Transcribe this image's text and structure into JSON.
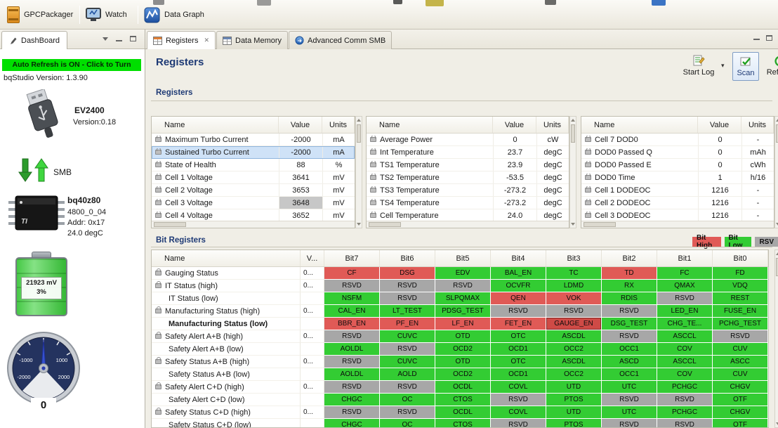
{
  "colors": {
    "bit_high": "#e05a56",
    "bit_low": "#33cc33",
    "bit_rsvd": "#a7a7a7",
    "accent_navy": "#1e3a75",
    "banner_green": "#00df00",
    "selection_blue": "#cfe2f7"
  },
  "toolbar": {
    "items": [
      {
        "label": "GPCPackager"
      },
      {
        "label": "Watch"
      },
      {
        "label": "Data Graph"
      }
    ]
  },
  "dashboard": {
    "tab_label": "DashBoard",
    "auto_refresh_banner": "Auto Refresh is ON - Click to Turn",
    "studio_version": "bqStudio Version: 1.3.90",
    "adapter_name": "EV2400",
    "adapter_version": "Version:0.18",
    "bus_label": "SMB",
    "device_name": "bq40z80",
    "device_fw": "4800_0_04",
    "device_addr": "Addr: 0x17",
    "device_temp": "24.0 degC",
    "battery_voltage": "21923 mV",
    "battery_soc": "3%",
    "gauge_labels": {
      "left": "-1000",
      "right": "1000",
      "lower_left": "-2000",
      "lower_right": "2000"
    },
    "gauge_value": "0"
  },
  "editor_tabs": [
    {
      "label": "Registers",
      "active": true
    },
    {
      "label": "Data Memory",
      "active": false
    },
    {
      "label": "Advanced Comm SMB",
      "active": false
    }
  ],
  "page_title": "Registers",
  "actions": {
    "start_log": "Start Log",
    "scan": "Scan",
    "refresh": "Refresh"
  },
  "registers_section": {
    "title": "Registers",
    "columns": [
      "Name",
      "Value",
      "Units"
    ],
    "tables": [
      {
        "rows": [
          {
            "name": "Maximum Turbo Current",
            "value": "-2000",
            "units": "mA"
          },
          {
            "name": "Sustained Turbo Current",
            "value": "-2000",
            "units": "mA",
            "selected": true
          },
          {
            "name": "State of Health",
            "value": "88",
            "units": "%"
          },
          {
            "name": "Cell 1 Voltage",
            "value": "3641",
            "units": "mV"
          },
          {
            "name": "Cell 2 Voltage",
            "value": "3653",
            "units": "mV"
          },
          {
            "name": "Cell 3 Voltage",
            "value": "3648",
            "units": "mV",
            "value_selected": true
          },
          {
            "name": "Cell 4 Voltage",
            "value": "3652",
            "units": "mV"
          }
        ]
      },
      {
        "rows": [
          {
            "name": "Average Power",
            "value": "0",
            "units": "cW"
          },
          {
            "name": "Int Temperature",
            "value": "23.7",
            "units": "degC"
          },
          {
            "name": "TS1 Temperature",
            "value": "23.9",
            "units": "degC"
          },
          {
            "name": "TS2 Temperature",
            "value": "-53.5",
            "units": "degC"
          },
          {
            "name": "TS3 Temperature",
            "value": "-273.2",
            "units": "degC"
          },
          {
            "name": "TS4 Temperature",
            "value": "-273.2",
            "units": "degC"
          },
          {
            "name": "Cell Temperature",
            "value": "24.0",
            "units": "degC"
          }
        ]
      },
      {
        "rows": [
          {
            "name": "Cell 7 DOD0",
            "value": "0",
            "units": "-"
          },
          {
            "name": "DOD0 Passed Q",
            "value": "0",
            "units": "mAh"
          },
          {
            "name": "DOD0 Passed E",
            "value": "0",
            "units": "cWh"
          },
          {
            "name": "DOD0 Time",
            "value": "1",
            "units": "h/16"
          },
          {
            "name": "Cell 1 DODEOC",
            "value": "1216",
            "units": "-"
          },
          {
            "name": "Cell 2 DODEOC",
            "value": "1216",
            "units": "-"
          },
          {
            "name": "Cell 3 DODEOC",
            "value": "1216",
            "units": "-"
          }
        ]
      }
    ]
  },
  "bit_section": {
    "title": "Bit Registers",
    "legend": [
      {
        "label": "Bit High",
        "type": "high"
      },
      {
        "label": "Bit Low",
        "type": "low"
      },
      {
        "label": "RSV",
        "type": "rsvd"
      }
    ],
    "columns": [
      "Name",
      "V...",
      "Bit7",
      "Bit6",
      "Bit5",
      "Bit4",
      "Bit3",
      "Bit2",
      "Bit1",
      "Bit0"
    ],
    "rows": [
      {
        "name": "Gauging Status",
        "lock": true,
        "value": "0...",
        "bits": [
          {
            "label": "CF",
            "state": "high"
          },
          {
            "label": "DSG",
            "state": "high"
          },
          {
            "label": "EDV",
            "state": "low"
          },
          {
            "label": "BAL_EN",
            "state": "low"
          },
          {
            "label": "TC",
            "state": "low"
          },
          {
            "label": "TD",
            "state": "high"
          },
          {
            "label": "FC",
            "state": "low"
          },
          {
            "label": "FD",
            "state": "low"
          }
        ]
      },
      {
        "name": "IT Status (high)",
        "lock": true,
        "value": "0...",
        "bits": [
          {
            "label": "RSVD",
            "state": "rsvd"
          },
          {
            "label": "RSVD",
            "state": "rsvd"
          },
          {
            "label": "RSVD",
            "state": "rsvd"
          },
          {
            "label": "OCVFR",
            "state": "low"
          },
          {
            "label": "LDMD",
            "state": "low"
          },
          {
            "label": "RX",
            "state": "low"
          },
          {
            "label": "QMAX",
            "state": "low"
          },
          {
            "label": "VDQ",
            "state": "low"
          }
        ]
      },
      {
        "name": "IT Status (low)",
        "indent": true,
        "value": "",
        "bits": [
          {
            "label": "NSFM",
            "state": "low"
          },
          {
            "label": "RSVD",
            "state": "rsvd"
          },
          {
            "label": "SLPQMAX",
            "state": "low"
          },
          {
            "label": "QEN",
            "state": "high"
          },
          {
            "label": "VOK",
            "state": "high"
          },
          {
            "label": "RDIS",
            "state": "low"
          },
          {
            "label": "RSVD",
            "state": "rsvd"
          },
          {
            "label": "REST",
            "state": "low"
          }
        ]
      },
      {
        "name": "Manufacturing Status (high)",
        "lock": true,
        "value": "0...",
        "bits": [
          {
            "label": "CAL_EN",
            "state": "low"
          },
          {
            "label": "LT_TEST",
            "state": "low"
          },
          {
            "label": "PDSG_TEST",
            "state": "low"
          },
          {
            "label": "RSVD",
            "state": "rsvd"
          },
          {
            "label": "RSVD",
            "state": "rsvd"
          },
          {
            "label": "RSVD",
            "state": "rsvd"
          },
          {
            "label": "LED_EN",
            "state": "low"
          },
          {
            "label": "FUSE_EN",
            "state": "low"
          }
        ]
      },
      {
        "name": "Manufacturing Status (low)",
        "indent": true,
        "bold": true,
        "value": "",
        "bits": [
          {
            "label": "BBR_EN",
            "state": "high"
          },
          {
            "label": "PF_EN",
            "state": "high"
          },
          {
            "label": "LF_EN",
            "state": "high"
          },
          {
            "label": "FET_EN",
            "state": "high"
          },
          {
            "label": "GAUGE_EN",
            "state": "high",
            "selected": true
          },
          {
            "label": "DSG_TEST",
            "state": "low"
          },
          {
            "label": "CHG_TE...",
            "state": "low"
          },
          {
            "label": "PCHG_TEST",
            "state": "low"
          }
        ]
      },
      {
        "name": "Safety Alert A+B (high)",
        "lock": true,
        "value": "0...",
        "bits": [
          {
            "label": "RSVD",
            "state": "rsvd"
          },
          {
            "label": "CUVC",
            "state": "low"
          },
          {
            "label": "OTD",
            "state": "low"
          },
          {
            "label": "OTC",
            "state": "low"
          },
          {
            "label": "ASCDL",
            "state": "low"
          },
          {
            "label": "RSVD",
            "state": "rsvd"
          },
          {
            "label": "ASCCL",
            "state": "low"
          },
          {
            "label": "RSVD",
            "state": "rsvd"
          }
        ]
      },
      {
        "name": "Safety Alert A+B (low)",
        "indent": true,
        "value": "",
        "bits": [
          {
            "label": "AOLDL",
            "state": "low"
          },
          {
            "label": "RSVD",
            "state": "rsvd"
          },
          {
            "label": "OCD2",
            "state": "low"
          },
          {
            "label": "OCD1",
            "state": "low"
          },
          {
            "label": "OCC2",
            "state": "low"
          },
          {
            "label": "OCC1",
            "state": "low"
          },
          {
            "label": "COV",
            "state": "low"
          },
          {
            "label": "CUV",
            "state": "low"
          }
        ]
      },
      {
        "name": "Safety Status A+B (high)",
        "lock": true,
        "value": "0...",
        "bits": [
          {
            "label": "RSVD",
            "state": "rsvd"
          },
          {
            "label": "CUVC",
            "state": "low"
          },
          {
            "label": "OTD",
            "state": "low"
          },
          {
            "label": "OTC",
            "state": "low"
          },
          {
            "label": "ASCDL",
            "state": "low"
          },
          {
            "label": "ASCD",
            "state": "low"
          },
          {
            "label": "ASCCL",
            "state": "low"
          },
          {
            "label": "ASCC",
            "state": "low"
          }
        ]
      },
      {
        "name": "Safety Status A+B (low)",
        "indent": true,
        "value": "",
        "bits": [
          {
            "label": "AOLDL",
            "state": "low"
          },
          {
            "label": "AOLD",
            "state": "low"
          },
          {
            "label": "OCD2",
            "state": "low"
          },
          {
            "label": "OCD1",
            "state": "low"
          },
          {
            "label": "OCC2",
            "state": "low"
          },
          {
            "label": "OCC1",
            "state": "low"
          },
          {
            "label": "COV",
            "state": "low"
          },
          {
            "label": "CUV",
            "state": "low"
          }
        ]
      },
      {
        "name": "Safety Alert C+D (high)",
        "lock": true,
        "value": "0...",
        "bits": [
          {
            "label": "RSVD",
            "state": "rsvd"
          },
          {
            "label": "RSVD",
            "state": "rsvd"
          },
          {
            "label": "OCDL",
            "state": "low"
          },
          {
            "label": "COVL",
            "state": "low"
          },
          {
            "label": "UTD",
            "state": "low"
          },
          {
            "label": "UTC",
            "state": "low"
          },
          {
            "label": "PCHGC",
            "state": "low"
          },
          {
            "label": "CHGV",
            "state": "low"
          }
        ]
      },
      {
        "name": "Safety Alert C+D (low)",
        "indent": true,
        "value": "",
        "bits": [
          {
            "label": "CHGC",
            "state": "low"
          },
          {
            "label": "OC",
            "state": "low"
          },
          {
            "label": "CTOS",
            "state": "low"
          },
          {
            "label": "RSVD",
            "state": "rsvd"
          },
          {
            "label": "PTOS",
            "state": "low"
          },
          {
            "label": "RSVD",
            "state": "rsvd"
          },
          {
            "label": "RSVD",
            "state": "rsvd"
          },
          {
            "label": "OTF",
            "state": "low"
          }
        ]
      },
      {
        "name": "Safety Status C+D (high)",
        "lock": true,
        "value": "0...",
        "bits": [
          {
            "label": "RSVD",
            "state": "rsvd"
          },
          {
            "label": "RSVD",
            "state": "rsvd"
          },
          {
            "label": "OCDL",
            "state": "low"
          },
          {
            "label": "COVL",
            "state": "low"
          },
          {
            "label": "UTD",
            "state": "low"
          },
          {
            "label": "UTC",
            "state": "low"
          },
          {
            "label": "PCHGC",
            "state": "low"
          },
          {
            "label": "CHGV",
            "state": "low"
          }
        ]
      },
      {
        "name": "Safety Status C+D (low)",
        "indent": true,
        "value": "",
        "bits": [
          {
            "label": "CHGC",
            "state": "low"
          },
          {
            "label": "OC",
            "state": "low"
          },
          {
            "label": "CTOS",
            "state": "low"
          },
          {
            "label": "RSVD",
            "state": "rsvd"
          },
          {
            "label": "PTOS",
            "state": "low"
          },
          {
            "label": "RSVD",
            "state": "rsvd"
          },
          {
            "label": "RSVD",
            "state": "rsvd"
          },
          {
            "label": "OTF",
            "state": "low"
          }
        ]
      }
    ]
  }
}
